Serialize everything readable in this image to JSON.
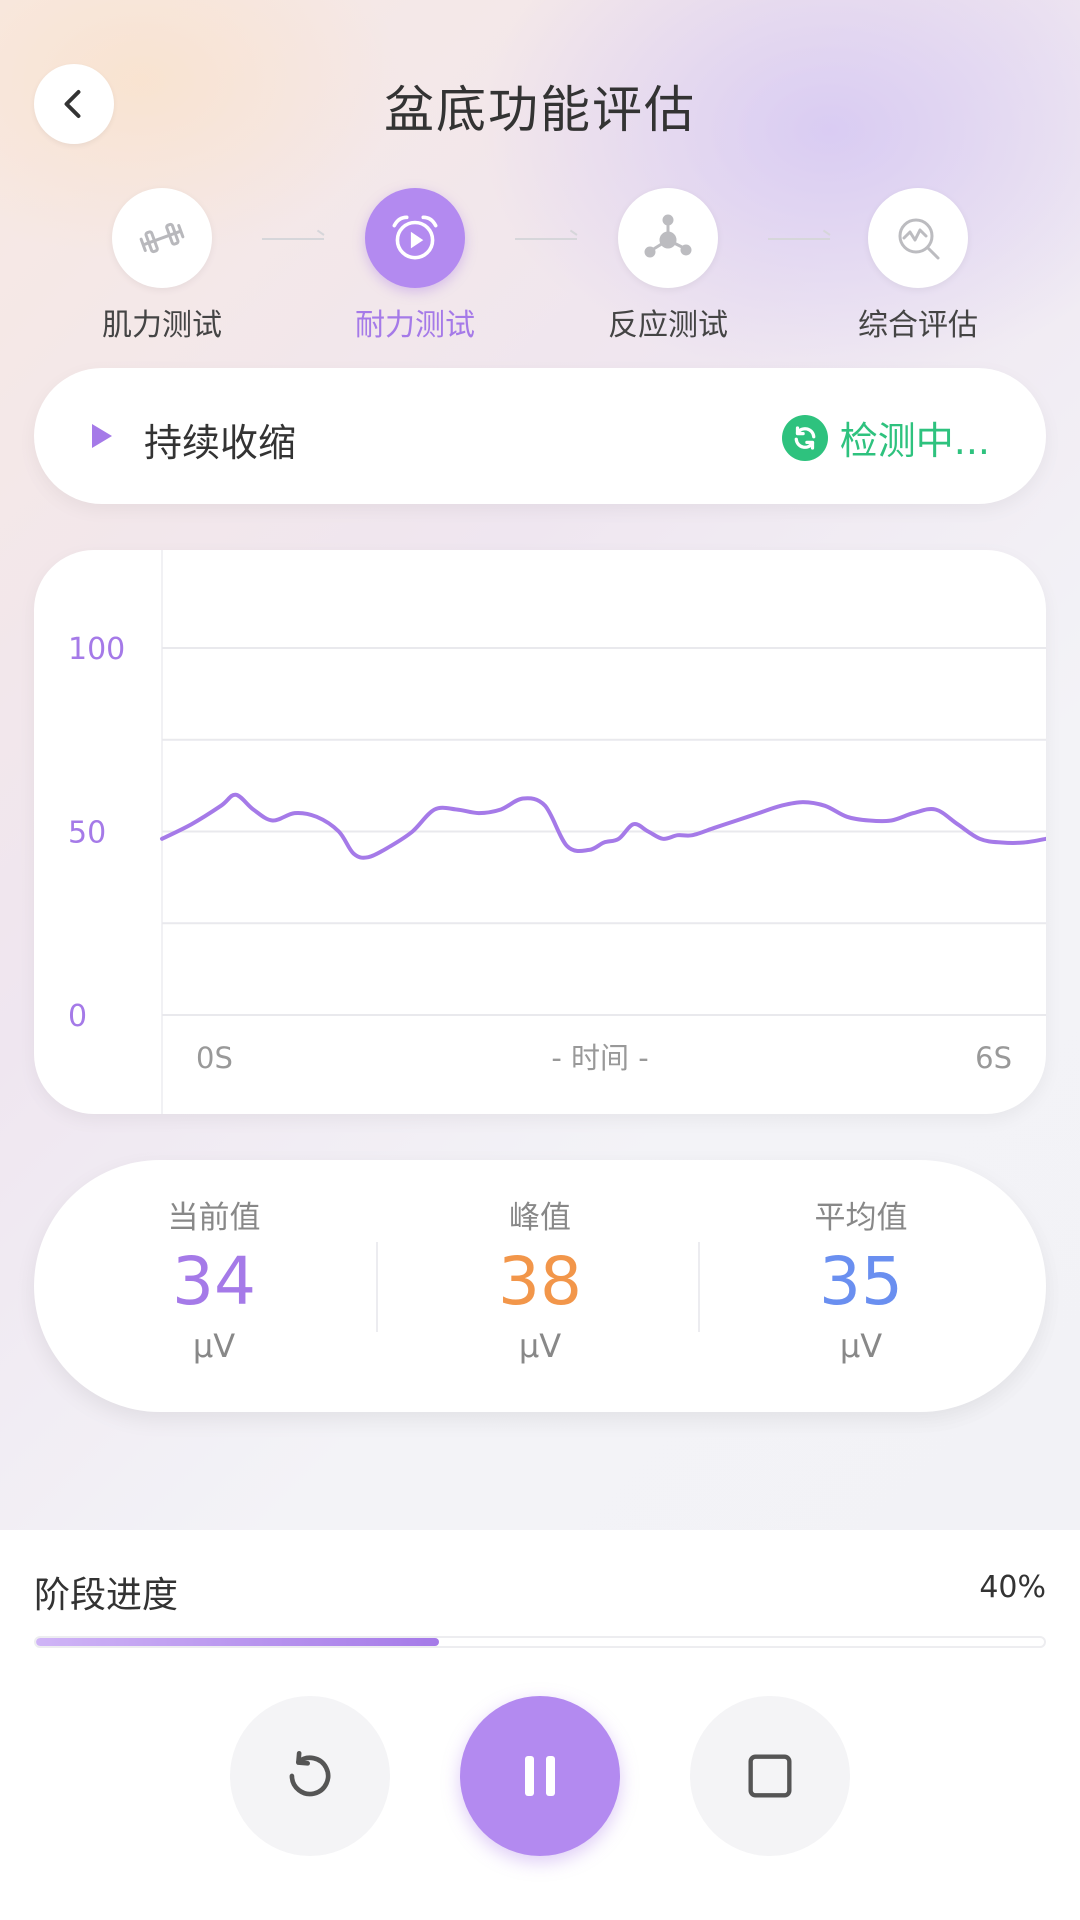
{
  "header": {
    "title": "盆底功能评估"
  },
  "steps": [
    {
      "label": "肌力测试",
      "icon": "dumbbell-icon",
      "active": false
    },
    {
      "label": "耐力测试",
      "icon": "alarm-play-icon",
      "active": true
    },
    {
      "label": "反应测试",
      "icon": "network-icon",
      "active": false
    },
    {
      "label": "综合评估",
      "icon": "chart-magnifier-icon",
      "active": false
    }
  ],
  "status": {
    "stage_name": "持续收缩",
    "detect_text": "检测中..."
  },
  "chart_data": {
    "type": "line",
    "y_ticks": [
      "100",
      "50",
      "0"
    ],
    "ylim": [
      0,
      100
    ],
    "x_labels": {
      "start": "0S",
      "center": "- 时间 -",
      "end": "6S"
    },
    "xlim": [
      0,
      6
    ],
    "grid": true,
    "series": [
      {
        "x": [
          0,
          0.2,
          0.4,
          0.5,
          0.62,
          0.75,
          0.9,
          1.05,
          1.2,
          1.3,
          1.4,
          1.55,
          1.7,
          1.85,
          2.0,
          2.15,
          2.3,
          2.45,
          2.6,
          2.75,
          2.9,
          3.0,
          3.1,
          3.2,
          3.3,
          3.4,
          3.5,
          3.6,
          3.75,
          3.9,
          4.05,
          4.2,
          4.35,
          4.5,
          4.65,
          4.8,
          4.95,
          5.1,
          5.25,
          5.4,
          5.55,
          5.7,
          5.85,
          6.0
        ],
        "values": [
          48,
          52,
          57,
          60,
          56,
          53,
          55,
          54,
          50,
          44,
          43,
          46,
          50,
          56,
          56,
          55,
          56,
          59,
          57,
          46,
          45,
          47,
          48,
          52,
          50,
          48,
          49,
          49,
          51,
          53,
          55,
          57,
          58,
          57,
          54,
          53,
          53,
          55,
          56,
          52,
          48,
          47,
          47,
          48
        ]
      }
    ],
    "line_color": "#a57ae8"
  },
  "stats": [
    {
      "label": "当前值",
      "value": "34",
      "unit": "μV",
      "color": "#a57ae8"
    },
    {
      "label": "峰值",
      "value": "38",
      "unit": "μV",
      "color": "#f2964a"
    },
    {
      "label": "平均值",
      "value": "35",
      "unit": "μV",
      "color": "#6a8ff0"
    }
  ],
  "progress": {
    "label": "阶段进度",
    "percent_text": "40%",
    "percent": 40
  },
  "controls": {
    "reset": "reset-icon",
    "pause": "pause-icon",
    "stop": "stop-icon"
  },
  "colors": {
    "accent": "#b38af0",
    "accent_text": "#a57ae8",
    "success": "#2ec27e"
  }
}
